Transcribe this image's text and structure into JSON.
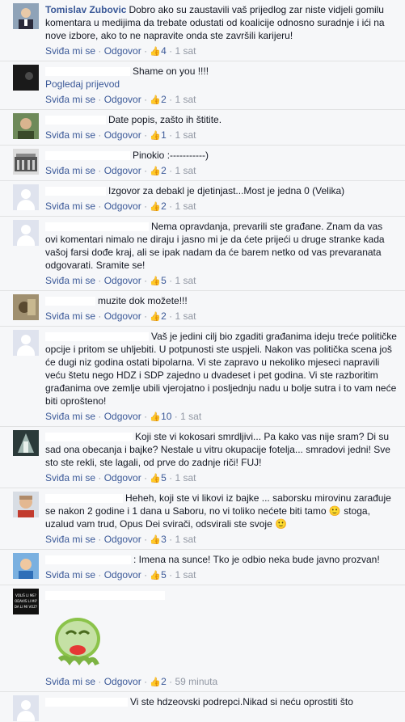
{
  "comments": [
    {
      "author": "Tomislav Zubovic",
      "text": "Dobro ako su zaustavili vaš prijedlog zar niste vidjeli gomilu komentara u medijima da trebate odustati od koalicije odnosno suradnje i ići na nove izbore, ako to ne napravite onda ste završili karijeru!",
      "like": "Sviđa mi se",
      "reply": "Odgovor",
      "likes": "4",
      "time": "1 sat"
    },
    {
      "text": "Shame on you !!!!",
      "see_translation": "Pogledaj prijevod",
      "like": "Sviđa mi se",
      "reply": "Odgovor",
      "likes": "2",
      "time": "1 sat"
    },
    {
      "text": "Date popis, zašto ih štitite.",
      "like": "Sviđa mi se",
      "reply": "Odgovor",
      "likes": "1",
      "time": "1 sat"
    },
    {
      "text": "Pinokio :-----------)",
      "like": "Sviđa mi se",
      "reply": "Odgovor",
      "likes": "2",
      "time": "1 sat"
    },
    {
      "text": "Izgovor za debakl je djetinjast...Most je jedna 0 (Velika)",
      "like": "Sviđa mi se",
      "reply": "Odgovor",
      "likes": "2",
      "time": "1 sat"
    },
    {
      "text": "Nema opravdanja, prevarili ste građane. Znam da vas ovi komentari nimalo ne diraju i jasno mi je da ćete prijeći u druge stranke kada vašoj farsi dođe kraj, ali se ipak nadam da će barem netko od vas prevaranata odgovarati. Sramite se!",
      "like": "Sviđa mi se",
      "reply": "Odgovor",
      "likes": "5",
      "time": "1 sat"
    },
    {
      "text": "muzite dok možete!!!",
      "like": "Sviđa mi se",
      "reply": "Odgovor",
      "likes": "2",
      "time": "1 sat"
    },
    {
      "text": "Vaš je jedini cilj bio zgaditi građanima ideju treće političke opcije i pritom se uhljebiti. U potpunosti ste uspjeli. Nakon vas politička scena još će dugi niz godina ostati bipolarna. Vi ste zapravo u nekoliko mjeseci napravili veću štetu nego HDZ i SDP zajedno u dvadeset i pet godina. Vi ste razboritim građanima ove zemlje ubili vjerojatno i posljednju nadu u bolje sutra i to vam neće biti oprošteno!",
      "like": "Sviđa mi se",
      "reply": "Odgovor",
      "likes": "10",
      "time": "1 sat"
    },
    {
      "text": "Koji ste vi kokosari smrdljivi... Pa kako vas nije sram? Di su sad ona obecanja i bajke? Nestale u vitru okupacije fotelja... smradovi jedni! Sve sto ste rekli, ste lagali, od prve do zadnje riči! FUJ!",
      "like": "Sviđa mi se",
      "reply": "Odgovor",
      "likes": "5",
      "time": "1 sat"
    },
    {
      "text_a": "Heheh, koji ste vi likovi iz bajke ... saborsku mirovinu zarađuje se nakon 2 godine i 1 dana u Saboru, no vi toliko nećete biti tamo",
      "text_b": "stoga, uzalud vam trud, Opus Dei svirači, odsvirali ste svoje",
      "like": "Sviđa mi se",
      "reply": "Odgovor",
      "likes": "3",
      "time": "1 sat"
    },
    {
      "text": ": Imena na sunce! Tko je odbio neka bude javno prozvan!",
      "like": "Sviđa mi se",
      "reply": "Odgovor",
      "likes": "5",
      "time": "1 sat"
    },
    {
      "avatar_text": "VOLIŠ LI ME? ODAVIS LI MI? DA LI MI VOZ?",
      "like": "Sviđa mi se",
      "reply": "Odgovor",
      "likes": "2",
      "time": "59 minuta"
    },
    {
      "text": "Vi ste hdzeovski podrepci.Nikad si neću oprostiti što"
    }
  ],
  "colors": {
    "link": "#3b5998",
    "meta": "#9197a3",
    "bg": "#f6f7f9",
    "border": "#e1e2e3"
  }
}
